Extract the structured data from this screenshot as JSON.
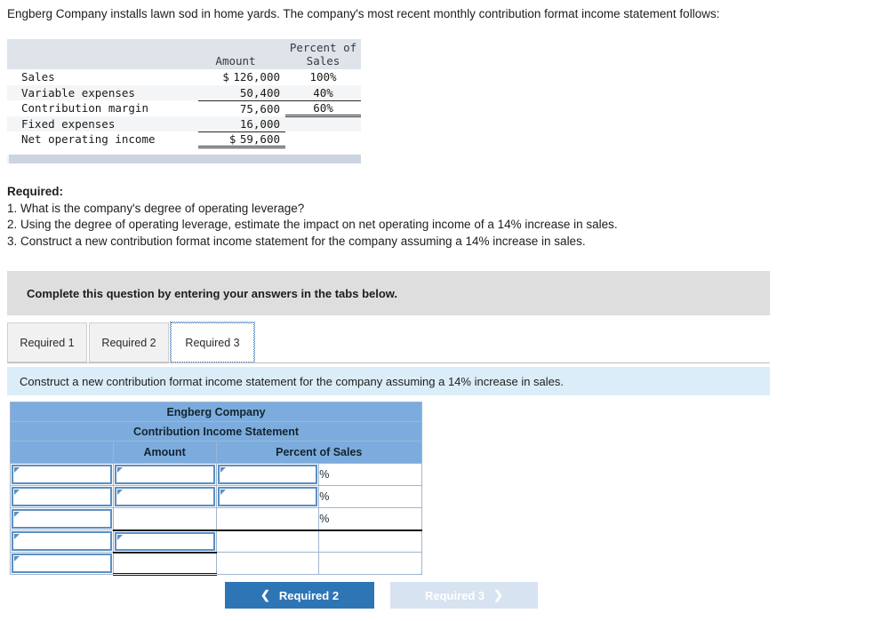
{
  "intro": "Engberg Company installs lawn sod in home yards. The company's most recent monthly contribution format income statement follows:",
  "income_statement": {
    "headers": {
      "label": "",
      "amount": "Amount",
      "percent_line1": "Percent of",
      "percent_line2": "Sales"
    },
    "rows": [
      {
        "label": "Sales",
        "dollar": "$",
        "amount": "126,000",
        "percent": "100%"
      },
      {
        "label": "Variable expenses",
        "dollar": "",
        "amount": "50,400",
        "percent": "40%"
      },
      {
        "label": "Contribution margin",
        "dollar": "",
        "amount": "75,600",
        "percent": "60%"
      },
      {
        "label": "Fixed expenses",
        "dollar": "",
        "amount": "16,000",
        "percent": ""
      },
      {
        "label": "Net operating income",
        "dollar": "$",
        "amount": "59,600",
        "percent": ""
      }
    ]
  },
  "required": {
    "title": "Required:",
    "items": [
      "1. What is the company's degree of operating leverage?",
      "2. Using the degree of operating leverage, estimate the impact on net operating income of a 14% increase in sales.",
      "3. Construct a new contribution format income statement for the company assuming a 14% increase in sales."
    ]
  },
  "instruction_bar": "Complete this question by entering your answers in the tabs below.",
  "tabs": [
    {
      "label": "Required 1",
      "active": false
    },
    {
      "label": "Required 2",
      "active": false
    },
    {
      "label": "Required 3",
      "active": true
    }
  ],
  "prompt_bar": "Construct a new contribution format income statement for the company assuming a 14% increase in sales.",
  "answer_table": {
    "title_line1": "Engberg Company",
    "title_line2": "Contribution Income Statement",
    "col_amount": "Amount",
    "col_percent": "Percent of Sales",
    "percent_symbols": [
      "%",
      "%",
      "%"
    ],
    "rows": [
      {
        "label": "",
        "amount": "",
        "percent": ""
      },
      {
        "label": "",
        "amount": "",
        "percent": ""
      },
      {
        "label": "",
        "amount": "",
        "percent": ""
      },
      {
        "label": "",
        "amount": "",
        "percent": ""
      },
      {
        "label": "",
        "amount": "",
        "percent": ""
      }
    ]
  },
  "nav": {
    "prev_label": "Required 2",
    "prev_icon": "chevron-left-icon",
    "next_label": "Required 3",
    "next_icon": "chevron-right-icon"
  },
  "colors": {
    "header_blue": "#7cacdd",
    "input_border": "#5b8fc4",
    "prompt_blue": "#dbedf9",
    "grey_bar": "#dedede",
    "button_blue": "#2e75b6",
    "button_disabled": "#d7e3f0",
    "stmt_header": "#dfe3ea"
  }
}
